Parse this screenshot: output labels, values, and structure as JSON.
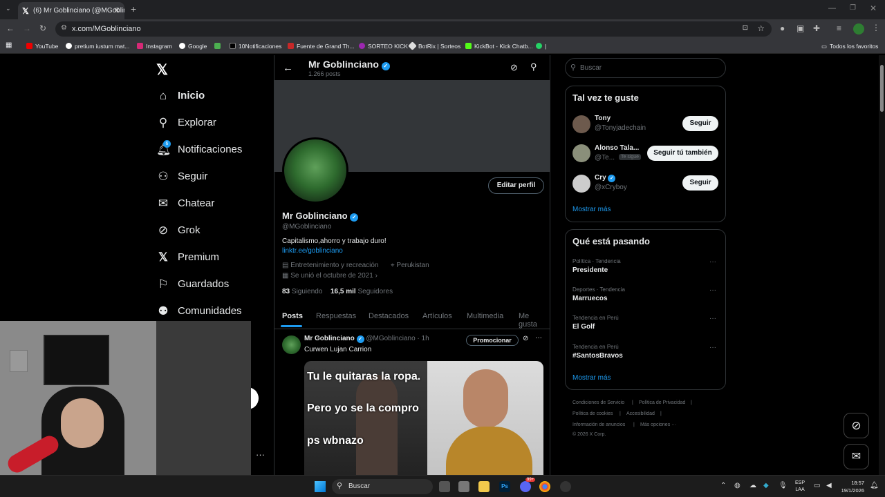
{
  "browser": {
    "tab_title": "(6) Mr Goblinciano (@MGoblinc",
    "url": "x.com/MGoblinciano",
    "bookmarks": [
      "YouTube",
      "pretium iustum mat...",
      "Instagram",
      "Google",
      "10Notificaciones",
      "Fuente de Grand Th...",
      "SORTEO KICK",
      "BotRix | Sorteos",
      "KickBot - Kick Chatb..."
    ],
    "all_bookmarks": "Todos los favoritos"
  },
  "nav": {
    "items": [
      "Inicio",
      "Explorar",
      "Notificaciones",
      "Seguir",
      "Chatear",
      "Grok",
      "Premium",
      "Guardados",
      "Comunidades"
    ],
    "notif_badge": "6"
  },
  "profile": {
    "header_name": "Mr Goblinciano",
    "post_count": "1.266 posts",
    "edit_button": "Editar perfil",
    "name": "Mr Goblinciano",
    "handle": "@MGoblinciano",
    "bio": "Capitalismo,ahorro y trabajo duro!",
    "link": "linktr.ee/goblinciano",
    "category": "Entretenimiento y recreación",
    "location": "Perukistan",
    "joined": "Se unió el octubre de 2021",
    "following_count": "83",
    "following_label": "Siguiendo",
    "followers_count": "16,5 mil",
    "followers_label": "Seguidores",
    "tabs": [
      "Posts",
      "Respuestas",
      "Destacados",
      "Artículos",
      "Multimedia",
      "Me gusta"
    ]
  },
  "post": {
    "author": "Mr Goblinciano",
    "handle": "@MGoblinciano",
    "time": "· 1h",
    "promote": "Promocionar",
    "more": "···",
    "text": "Curwen Lujan Carrion",
    "meme_line1": "Tu le quitaras la ropa.",
    "meme_line2": "Pero yo se la compro",
    "meme_line3": "ps wbnazo"
  },
  "search": {
    "placeholder": "Buscar"
  },
  "suggestions": {
    "title": "Tal vez te guste",
    "users": [
      {
        "name": "Tony",
        "handle": "@Tonyjadechain",
        "button": "Seguir",
        "badge": ""
      },
      {
        "name": "Alonso Tala...",
        "handle": "@Te...",
        "button": "Seguir tú también",
        "badge": "Te sigue"
      },
      {
        "name": "Cry",
        "handle": "@xCryboy",
        "button": "Seguir",
        "badge": ""
      }
    ],
    "more": "Mostrar más"
  },
  "trends": {
    "title": "Qué está pasando",
    "items": [
      {
        "context": "Política · Tendencia",
        "topic": "Presidente"
      },
      {
        "context": "Deportes · Tendencia",
        "topic": "Marruecos"
      },
      {
        "context": "Tendencia en Perú",
        "topic": "El Golf"
      },
      {
        "context": "Tendencia en Perú",
        "topic": "#SantosBravos"
      }
    ],
    "more": "Mostrar más",
    "dots": "···"
  },
  "footer": {
    "links": [
      "Condiciones de Servicio",
      "|",
      "Política de Privacidad",
      "|",
      "Política de cookies",
      "|",
      "Accesibilidad",
      "|",
      "Información de anuncios",
      "|",
      "Más opciones ···"
    ],
    "copyright": "© 2026 X Corp."
  },
  "taskbar": {
    "search": "Buscar",
    "lang1": "ESP",
    "lang2": "LAA",
    "time": "18:57",
    "date": "19/1/2026",
    "chat_badge": "99+"
  },
  "colors": {
    "accent": "#1d9bf0",
    "bg": "#000000",
    "border": "#2f3336"
  }
}
